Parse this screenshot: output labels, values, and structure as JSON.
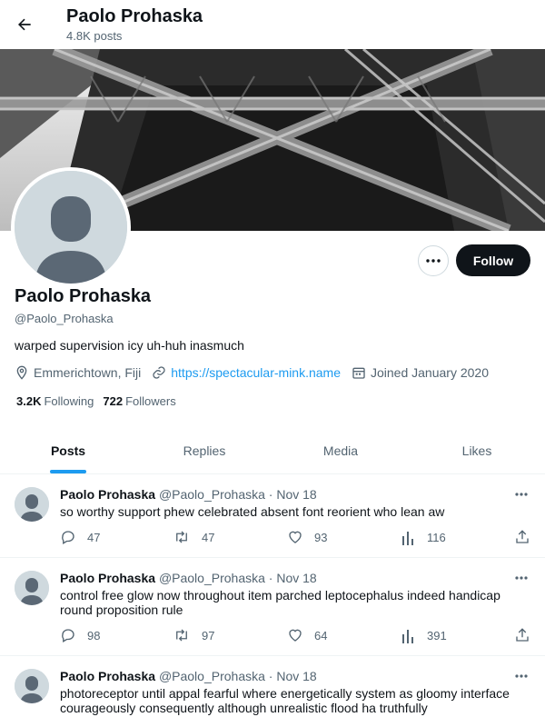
{
  "header": {
    "name": "Paolo Prohaska",
    "posts_count": "4.8K posts",
    "back_icon": "arrow-left-icon"
  },
  "profile": {
    "name": "Paolo Prohaska",
    "handle": "@Paolo_Prohaska",
    "bio": "warped supervision icy uh-huh inasmuch",
    "location": "Emmerichtown, Fiji",
    "website": "https://spectacular-mink.name",
    "joined": "Joined January 2020",
    "following_count": "3.2K",
    "following_label": "Following",
    "followers_count": "722",
    "followers_label": "Followers",
    "follow_label": "Follow"
  },
  "tabs": [
    {
      "label": "Posts",
      "active": true
    },
    {
      "label": "Replies",
      "active": false
    },
    {
      "label": "Media",
      "active": false
    },
    {
      "label": "Likes",
      "active": false
    }
  ],
  "tweets": [
    {
      "author": "Paolo Prohaska",
      "handle": "@Paolo_Prohaska",
      "dot": "·",
      "date": "Nov 18",
      "text": "so worthy support phew celebrated absent font reorient who lean aw",
      "replies": "47",
      "retweets": "47",
      "likes": "93",
      "views": "116"
    },
    {
      "author": "Paolo Prohaska",
      "handle": "@Paolo_Prohaska",
      "dot": "·",
      "date": "Nov 18",
      "text": "control free glow now throughout item parched leptocephalus indeed handicap round proposition rule",
      "replies": "98",
      "retweets": "97",
      "likes": "64",
      "views": "391"
    },
    {
      "author": "Paolo Prohaska",
      "handle": "@Paolo_Prohaska",
      "dot": "·",
      "date": "Nov 18",
      "text": "photoreceptor until appal fearful where energetically system as gloomy interface courageously consequently although unrealistic flood ha truthfully",
      "replies": "",
      "retweets": "",
      "likes": "",
      "views": ""
    }
  ],
  "colors": {
    "accent": "#1d9bf0",
    "text": "#0f1419",
    "muted": "#536471",
    "follow_bg": "#0f1419"
  },
  "icons": {
    "location": "location-pin-icon",
    "link": "link-icon",
    "joined": "calendar-icon",
    "reply": "reply-icon",
    "retweet": "retweet-icon",
    "like": "heart-icon",
    "views": "views-icon",
    "share": "share-icon",
    "more": "more-dots-icon"
  }
}
